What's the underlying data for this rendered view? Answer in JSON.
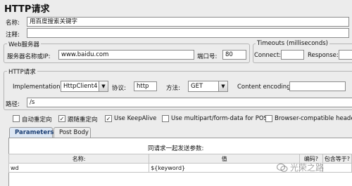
{
  "window": {
    "title": "HTTP请求"
  },
  "name_field": {
    "label": "名称:",
    "value": "用百度搜索关键字"
  },
  "comment_field": {
    "label": "注释:",
    "value": ""
  },
  "web_server": {
    "legend": "Web服务器",
    "host_label": "服务器名称或IP:",
    "host_value": "www.baidu.com",
    "port_label": "端口号:",
    "port_value": "80"
  },
  "timeouts": {
    "legend": "Timeouts (milliseconds)",
    "connect_label": "Connect:",
    "connect_value": "",
    "response_label": "Response:",
    "response_value": ""
  },
  "http_request": {
    "legend": "HTTP请求",
    "implementation_label": "Implementation:",
    "implementation_value": "HttpClient4",
    "protocol_label": "协议:",
    "protocol_value": "http",
    "method_label": "方法:",
    "method_value": "GET",
    "encoding_label": "Content encoding:",
    "encoding_value": "",
    "path_label": "路径:",
    "path_value": "/s"
  },
  "options": [
    {
      "label": "自动重定向",
      "checked": false
    },
    {
      "label": "跟随重定向",
      "checked": true
    },
    {
      "label": "Use KeepAlive",
      "checked": true
    },
    {
      "label": "Use multipart/form-data for POST",
      "checked": false
    },
    {
      "label": "Browser-compatible headers",
      "checked": false
    }
  ],
  "tabs": [
    {
      "label": "Parameters",
      "active": true
    },
    {
      "label": "Post Body",
      "active": false
    }
  ],
  "params_table": {
    "caption": "同请求一起发送参数:",
    "columns": [
      "名称:",
      "值",
      "编码?",
      "包含等于?"
    ],
    "rows": [
      {
        "name": "wd",
        "value": "${keyword}",
        "encode": "",
        "include_equals": ""
      }
    ]
  },
  "watermark": {
    "text": "光荣之路",
    "icon": "wechat-icon"
  }
}
